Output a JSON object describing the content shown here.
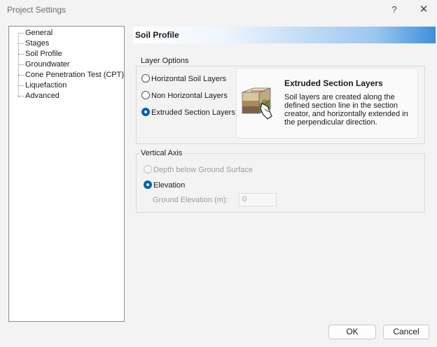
{
  "window": {
    "title": "Project Settings",
    "help_label": "?",
    "close_label": "✕"
  },
  "tree": {
    "items": [
      {
        "label": "General"
      },
      {
        "label": "Stages"
      },
      {
        "label": "Soil Profile"
      },
      {
        "label": "Groundwater"
      },
      {
        "label": "Cone Penetration Test (CPT)"
      },
      {
        "label": "Liquefaction"
      },
      {
        "label": "Advanced"
      }
    ],
    "selected": "Soil Profile"
  },
  "header": {
    "title": "Soil Profile"
  },
  "layer_options": {
    "label": "Layer Options",
    "options": [
      {
        "label": "Horizontal Soil Layers",
        "checked": false
      },
      {
        "label": "Non Horizontal Layers",
        "checked": false
      },
      {
        "label": "Extruded Section Layers",
        "checked": true
      }
    ],
    "info": {
      "title": "Extruded Section Layers",
      "description": "Soil layers are created along the defined section line in the section creator, and horizontally extended in the perpendicular direction.",
      "icon": "extruded-section-icon"
    }
  },
  "vertical_axis": {
    "label": "Vertical Axis",
    "options": [
      {
        "label": "Depth below Ground Surface",
        "checked": false,
        "disabled": true
      },
      {
        "label": "Elevation",
        "checked": true,
        "disabled": false
      }
    ],
    "ground_elevation_label": "Ground Elevation (m):",
    "ground_elevation_value": "0"
  },
  "buttons": {
    "ok": "OK",
    "cancel": "Cancel"
  },
  "colors": {
    "accent": "#005fb8",
    "header_gradient_end": "#3d8fdb"
  }
}
